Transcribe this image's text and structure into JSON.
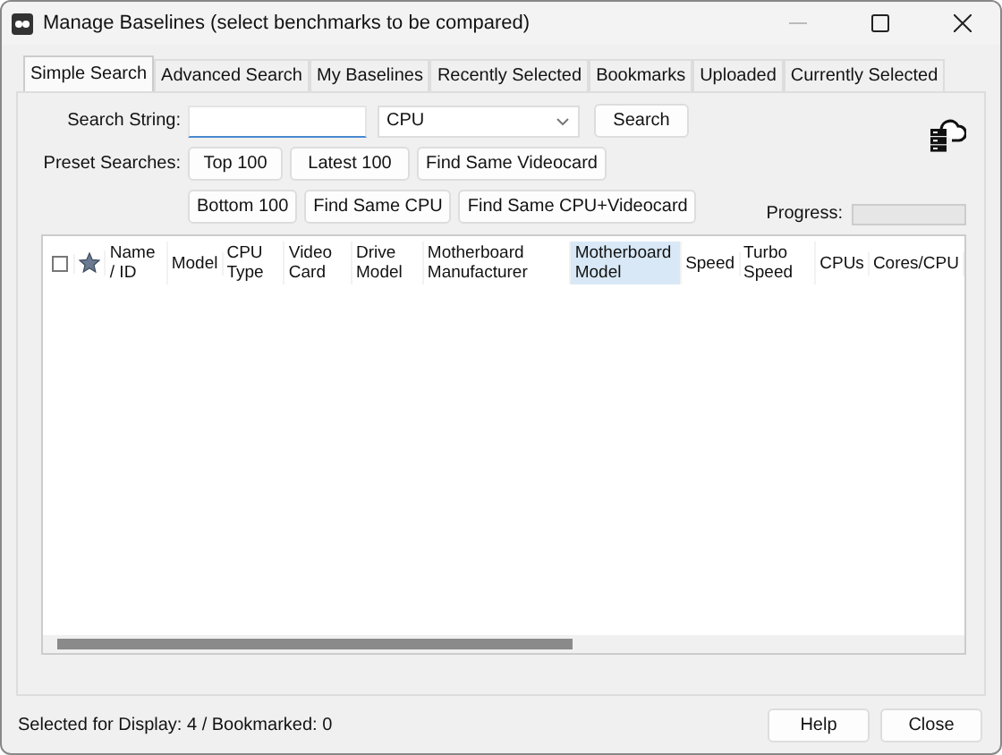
{
  "window": {
    "title": "Manage Baselines (select benchmarks to be compared)"
  },
  "tabs": [
    {
      "label": "Simple Search",
      "selected": true
    },
    {
      "label": "Advanced Search",
      "selected": false
    },
    {
      "label": "My Baselines",
      "selected": false
    },
    {
      "label": "Recently Selected",
      "selected": false
    },
    {
      "label": "Bookmarks",
      "selected": false
    },
    {
      "label": "Uploaded",
      "selected": false
    },
    {
      "label": "Currently Selected",
      "selected": false
    }
  ],
  "search": {
    "label": "Search String:",
    "category": "CPU",
    "button": "Search"
  },
  "presets": {
    "label": "Preset Searches:",
    "rows": [
      [
        "Top 100",
        "Latest 100",
        "Find Same Videocard"
      ],
      [
        "Bottom 100",
        "Find Same CPU",
        "Find Same CPU+Videocard"
      ]
    ]
  },
  "progress": {
    "label": "Progress:",
    "level": 0
  },
  "table": {
    "select_all_checked": false,
    "columns": [
      {
        "label": "Name / ID",
        "selected": false
      },
      {
        "label": "Model",
        "selected": false
      },
      {
        "label": "CPU Type",
        "selected": false
      },
      {
        "label": "Video Card",
        "selected": false
      },
      {
        "label": "Drive Model",
        "selected": false
      },
      {
        "label": "Motherboard Manufacturer",
        "selected": false
      },
      {
        "label": "Motherboard Model",
        "selected": true
      },
      {
        "label": "Speed",
        "selected": false
      },
      {
        "label": "Turbo Speed",
        "selected": false
      },
      {
        "label": "CPUs",
        "selected": false
      },
      {
        "label": "Cores/CPU",
        "selected": false
      }
    ]
  },
  "status_bar": {
    "text": "Selected for Display: 4 / Bookmarked: 0"
  },
  "buttons": [
    "Help",
    "Close"
  ]
}
